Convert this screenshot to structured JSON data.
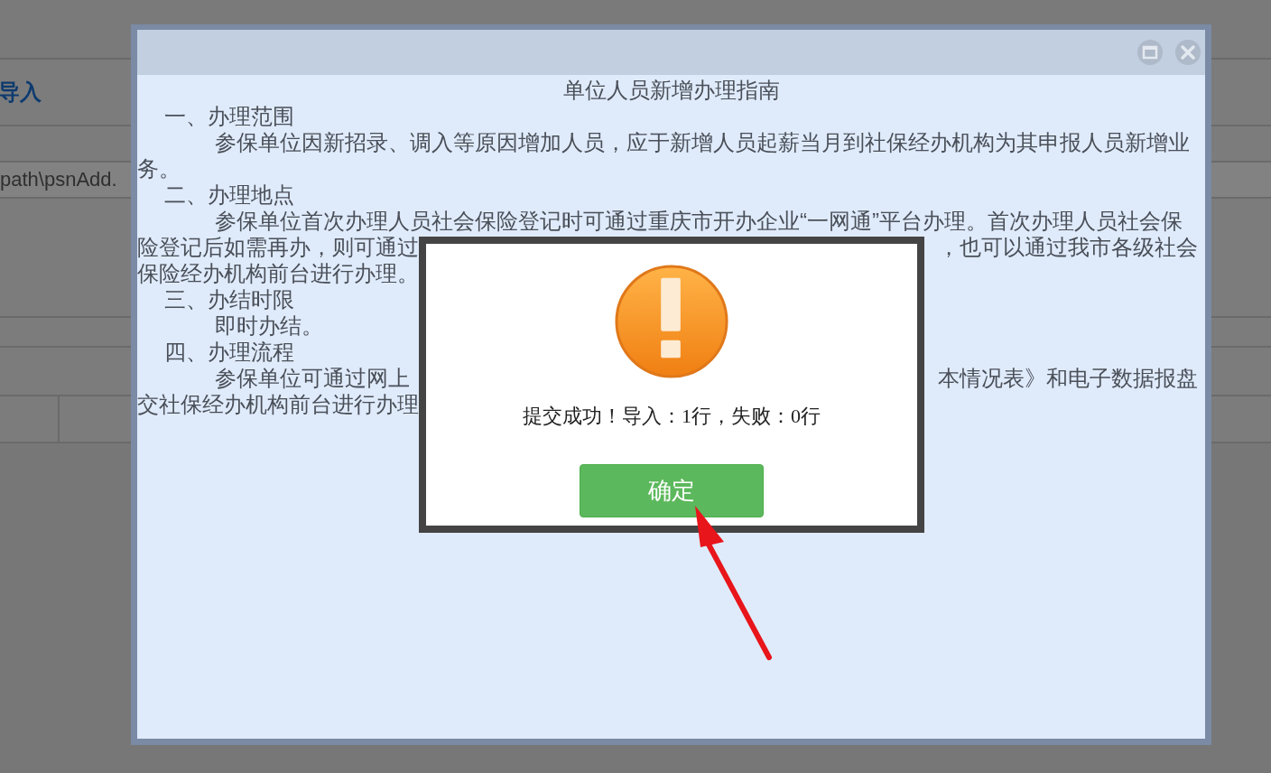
{
  "background_page": {
    "section_title": "导入",
    "file_path": "path\\psnAdd."
  },
  "guide": {
    "title": "单位人员新增办理指南",
    "lines": [
      {
        "kind": "heading",
        "left": "一、办理范围"
      },
      {
        "kind": "body",
        "left": "参保单位因新招录、调入等原因增加人员，应于新增人员起薪当月到社保经办机构为其申报人员新增业"
      },
      {
        "kind": "wrap",
        "left": "务。"
      },
      {
        "kind": "heading",
        "left": "二、办理地点"
      },
      {
        "kind": "body",
        "left": "参保单位首次办理人员社会保险登记时可通过重庆市开办企业“一网通”平台办理。首次办理人员社会保"
      },
      {
        "kind": "wrap",
        "left": "险登记后如需再办，则可通过",
        "right": "，也可以通过我市各级社会"
      },
      {
        "kind": "wrap",
        "left": "保险经办机构前台进行办理。"
      },
      {
        "kind": "heading",
        "left": "三、办结时限"
      },
      {
        "kind": "body",
        "left": "即时办结。"
      },
      {
        "kind": "heading",
        "left": "四、办理流程"
      },
      {
        "kind": "body",
        "left": "参保单位可通过网上",
        "right": "本情况表》和电子数据报盘"
      },
      {
        "kind": "wrap",
        "left": "交社保经办机构前台进行办理"
      }
    ]
  },
  "alert": {
    "message": "提交成功！导入：1行，失败：0行",
    "button": "确定"
  }
}
